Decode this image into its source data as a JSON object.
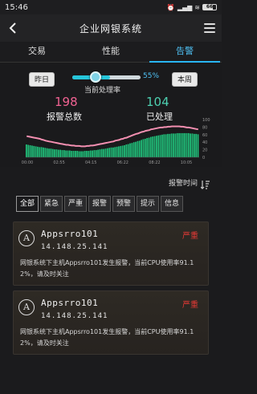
{
  "status_bar": {
    "time": "15:46",
    "battery": "66"
  },
  "app_bar": {
    "title": "企业网银系统"
  },
  "tabs": [
    {
      "label": "交易",
      "active": false
    },
    {
      "label": "性能",
      "active": false
    },
    {
      "label": "告警",
      "active": true
    }
  ],
  "dashboard": {
    "day_button": "昨日",
    "week_button": "本周",
    "rate_percent": "55%",
    "rate_value": 0.55,
    "rate_label": "当前处理率",
    "alarm_total": "198",
    "alarm_total_label": "报警总数",
    "handled": "104",
    "handled_label": "已处理"
  },
  "chart_data": {
    "type": "bar",
    "x_ticks": [
      "00:00",
      "02:55",
      "04:15",
      "06:22",
      "08:22",
      "10:05"
    ],
    "y_ticks": [
      "100",
      "80",
      "60",
      "40",
      "20",
      "0"
    ],
    "ylim": [
      0,
      100
    ],
    "values": [
      34,
      33,
      32,
      31,
      30,
      29,
      28,
      27,
      27,
      26,
      25,
      24,
      23,
      23,
      22,
      21,
      21,
      20,
      20,
      19,
      19,
      18,
      18,
      18,
      17,
      17,
      17,
      17,
      16,
      16,
      16,
      17,
      17,
      17,
      18,
      18,
      19,
      19,
      20,
      21,
      22,
      22,
      23,
      24,
      25,
      26,
      26,
      27,
      28,
      29,
      30,
      31,
      32,
      34,
      35,
      37,
      38,
      40,
      41,
      43,
      44,
      46,
      48,
      49,
      51,
      52,
      54,
      55,
      56,
      57,
      58,
      59,
      60,
      61,
      61,
      62,
      62,
      63,
      63,
      63,
      64,
      64,
      64,
      64,
      64,
      64,
      64,
      63,
      63,
      62,
      62,
      61
    ],
    "line": [
      56,
      55,
      54,
      53,
      52,
      51,
      50,
      49,
      47,
      46,
      44,
      43,
      42,
      41,
      40,
      39,
      38,
      37,
      36,
      35,
      34,
      33,
      33,
      32,
      31,
      31,
      30,
      30,
      30,
      29,
      29,
      29,
      30,
      30,
      31,
      31,
      32,
      33,
      34,
      35,
      36,
      37,
      38,
      39,
      40,
      41,
      42,
      44,
      45,
      46,
      48,
      49,
      51,
      52,
      54,
      56,
      58,
      60,
      62,
      63,
      65,
      67,
      68,
      70,
      71,
      72,
      74,
      75,
      76,
      77,
      78,
      79,
      79,
      80,
      80,
      81,
      81,
      82,
      82,
      82,
      82,
      82,
      81,
      81,
      80,
      79,
      79,
      78,
      77,
      76,
      75,
      74
    ],
    "bar_color": "#20c07a",
    "line_color": "#f48fb1"
  },
  "alarm_time": {
    "label": "报警时间"
  },
  "filters": [
    {
      "label": "全部",
      "active": true
    },
    {
      "label": "紧急",
      "active": false
    },
    {
      "label": "严重",
      "active": false
    },
    {
      "label": "报警",
      "active": false
    },
    {
      "label": "预警",
      "active": false
    },
    {
      "label": "提示",
      "active": false
    },
    {
      "label": "信息",
      "active": false
    }
  ],
  "alarms": [
    {
      "icon_letter": "A",
      "name": "Appsrro101",
      "ip": "14.148.25.141",
      "severity": "严重",
      "message": "网银系统下主机Appsrro101发生报警，当前CPU使用率91.12%，请及时关注"
    },
    {
      "icon_letter": "A",
      "name": "Appsrro101",
      "ip": "14.148.25.141",
      "severity": "严重",
      "message": "网银系统下主机Appsrro101发生报警，当前CPU使用率91.12%，请及时关注"
    }
  ],
  "colors": {
    "accent": "#29b6f6",
    "severity": "#e53935",
    "alarm_num": "#f06292",
    "handled_num": "#4dd0b1"
  }
}
